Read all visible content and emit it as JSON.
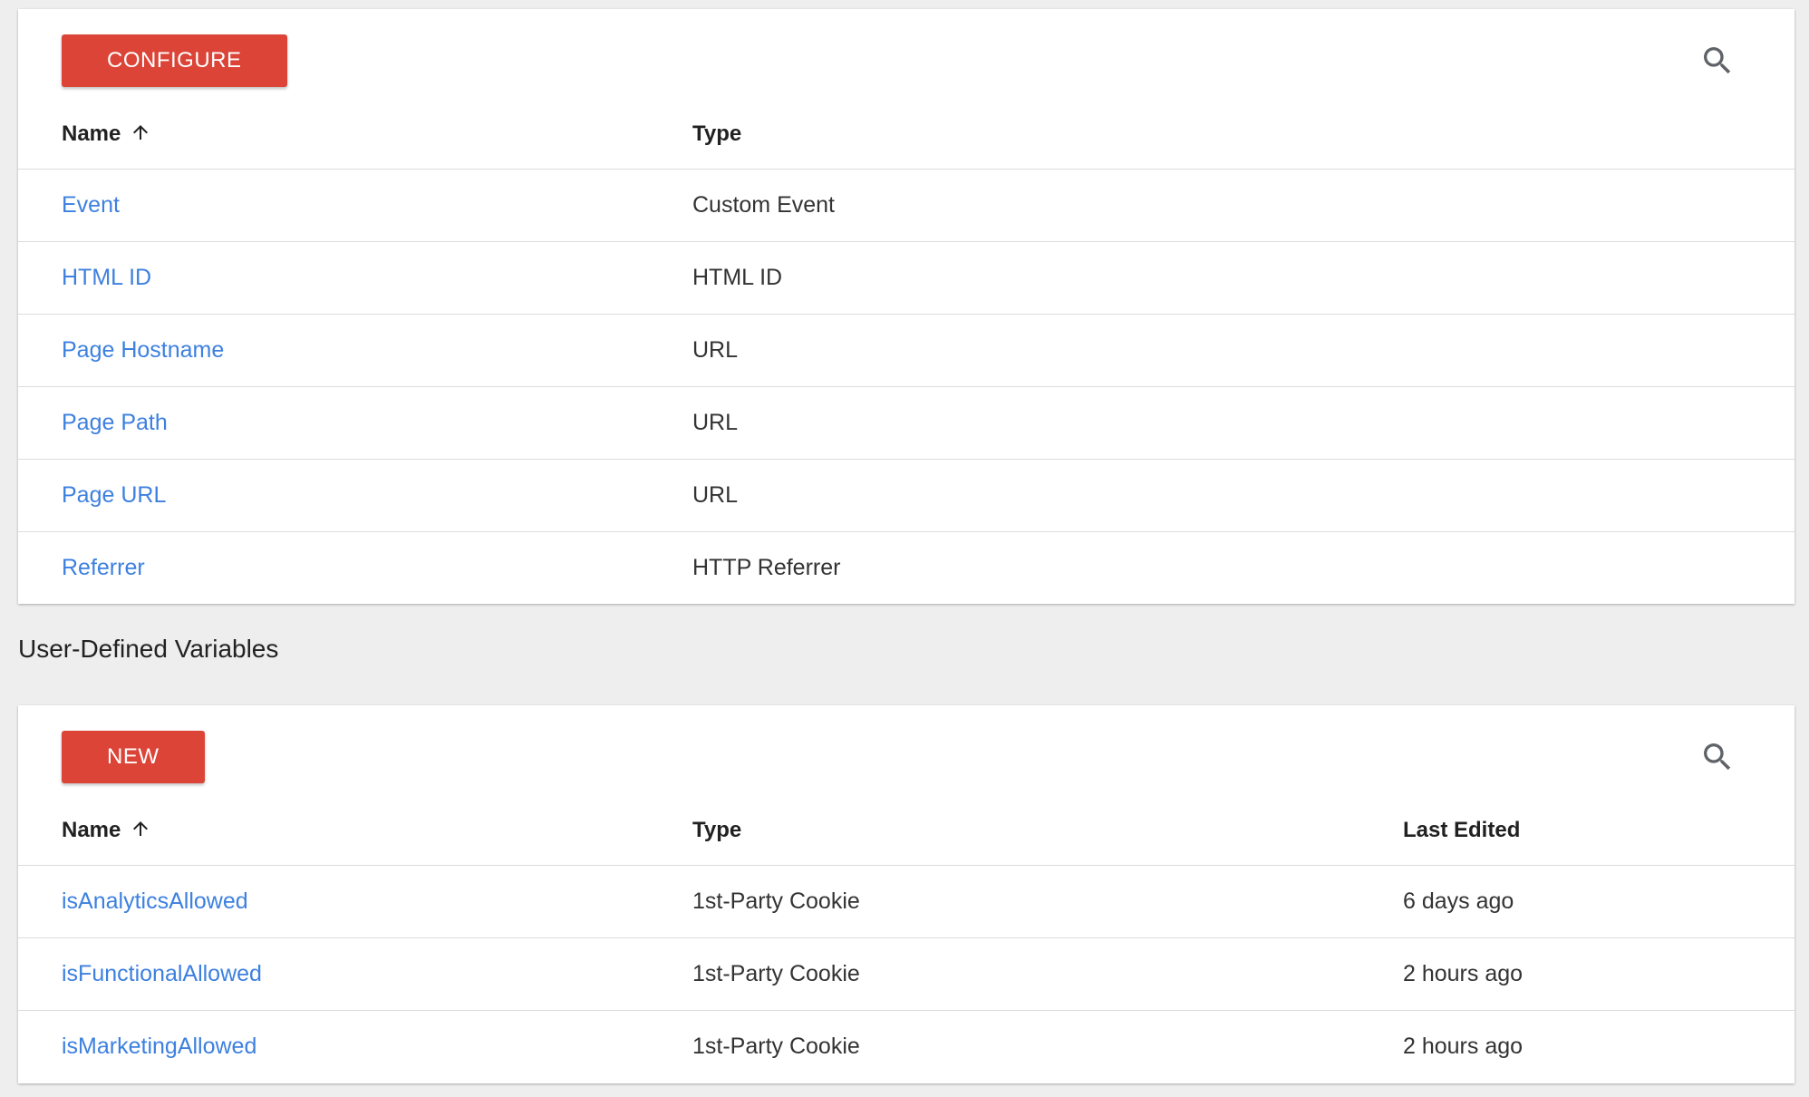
{
  "builtin_variables": {
    "configure_label": "CONFIGURE",
    "headers": {
      "name": "Name",
      "type": "Type"
    },
    "rows": [
      {
        "name": "Event",
        "type": "Custom Event"
      },
      {
        "name": "HTML ID",
        "type": "HTML ID"
      },
      {
        "name": "Page Hostname",
        "type": "URL"
      },
      {
        "name": "Page Path",
        "type": "URL"
      },
      {
        "name": "Page URL",
        "type": "URL"
      },
      {
        "name": "Referrer",
        "type": "HTTP Referrer"
      }
    ]
  },
  "user_defined_variables": {
    "title": "User-Defined Variables",
    "new_label": "NEW",
    "headers": {
      "name": "Name",
      "type": "Type",
      "last_edited": "Last Edited"
    },
    "rows": [
      {
        "name": "isAnalyticsAllowed",
        "type": "1st-Party Cookie",
        "last_edited": "6 days ago"
      },
      {
        "name": "isFunctionalAllowed",
        "type": "1st-Party Cookie",
        "last_edited": "2 hours ago"
      },
      {
        "name": "isMarketingAllowed",
        "type": "1st-Party Cookie",
        "last_edited": "2 hours ago"
      }
    ]
  },
  "icons": {
    "search": "search-icon",
    "sort": "arrow-up-icon"
  },
  "colors": {
    "accent_red": "#db4437",
    "link_blue": "#3d80df",
    "background": "#eeeeee"
  }
}
